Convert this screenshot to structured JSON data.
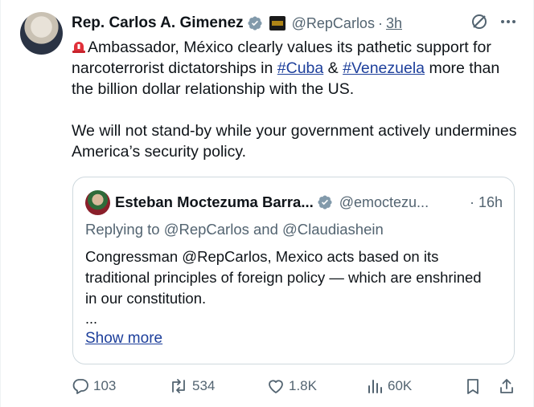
{
  "author": {
    "name": "Rep. Carlos A. Gimenez",
    "handle": "@RepCarlos",
    "separator": "·",
    "time": "3h"
  },
  "body": {
    "line1_pre": "Ambassador, México clearly values its pathetic support for narcoterrorist dictatorships in ",
    "hashtag1": "#Cuba",
    "amp": " & ",
    "hashtag2": "#Venezuela",
    "line1_post": " more than the billion dollar relationship with the US.",
    "paragraph2": "We will not stand-by while your government actively undermines America’s security policy."
  },
  "quote": {
    "name": "Esteban Moctezuma Barra...",
    "handle": "@emoctezu...",
    "time": "· 16h",
    "replying": "Replying to @RepCarlos and @Claudiashein",
    "text": "Congressman @RepCarlos, Mexico acts based on its traditional principles of foreign policy — which are enshrined in our constitution.",
    "ellipsis": "...",
    "show_more": "Show more"
  },
  "actions": {
    "replies": "103",
    "reposts": "534",
    "likes": "1.8K",
    "views": "60K"
  },
  "icons": [
    "verified-badge-icon",
    "grok-icon",
    "more-icon",
    "siren-icon",
    "reply-icon",
    "repost-icon",
    "like-icon",
    "views-icon",
    "bookmark-icon",
    "share-icon"
  ],
  "colors": {
    "link": "#1d3f9b",
    "secondary": "#536471",
    "border": "#cfd9de"
  }
}
